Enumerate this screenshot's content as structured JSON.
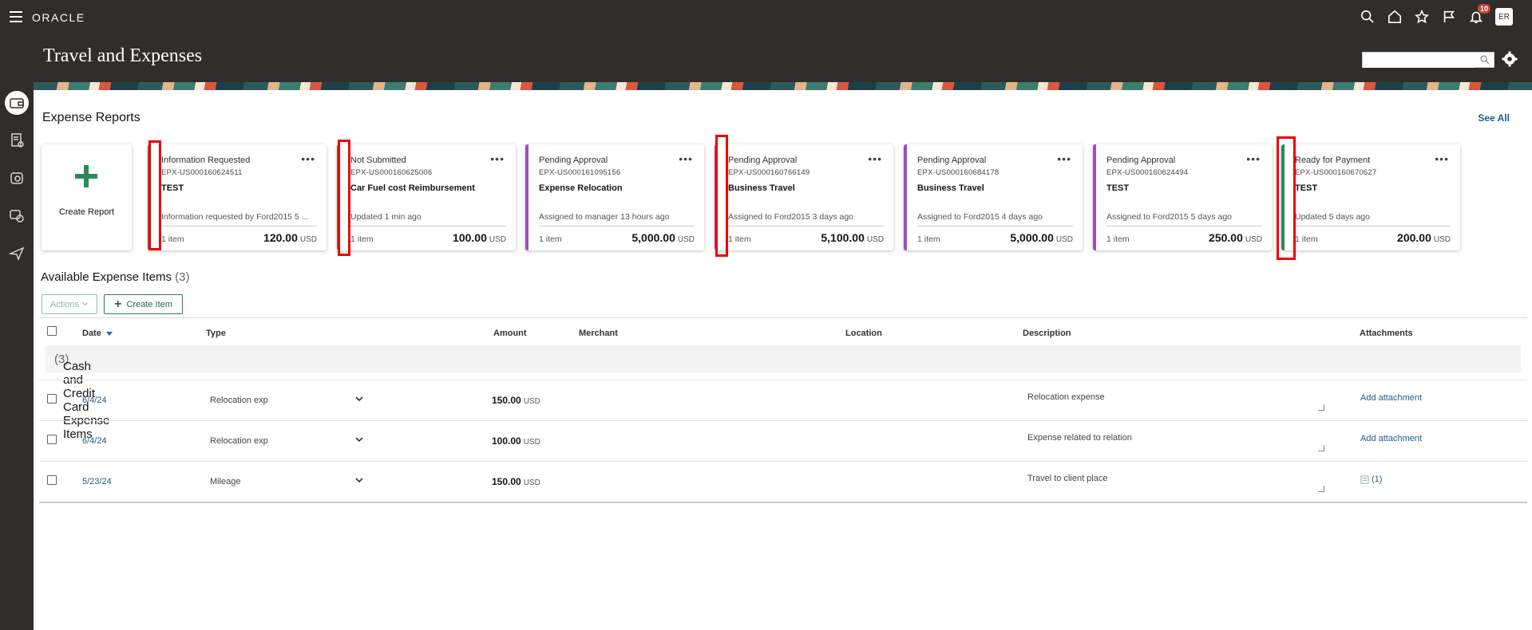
{
  "header": {
    "logo": "ORACLE",
    "title": "Travel and Expenses",
    "notification_count": "10",
    "avatar_initials": "ER",
    "search_placeholder": ""
  },
  "expense_reports": {
    "title": "Expense Reports",
    "see_all": "See All",
    "create_label": "Create Report",
    "cards": [
      {
        "status": "Information Requested",
        "number": "EPX-US000160624511",
        "name": "TEST",
        "info": "Information requested by Ford2015 5 ...",
        "items": "1 item",
        "amount": "120.00",
        "currency": "USD",
        "color": "gray"
      },
      {
        "status": "Not Submitted",
        "number": "EPX-US000160625006",
        "name": "Car Fuel cost Reimbursement",
        "info": "Updated 1 min ago",
        "items": "1 item",
        "amount": "100.00",
        "currency": "USD",
        "color": "gray"
      },
      {
        "status": "Pending Approval",
        "number": "EPX-US000161095156",
        "name": "Expense Relocation",
        "info": "Assigned to manager 13 hours ago",
        "items": "1 item",
        "amount": "5,000.00",
        "currency": "USD",
        "color": "purple"
      },
      {
        "status": "Pending Approval",
        "number": "EPX-US000160766149",
        "name": "Business Travel",
        "info": "Assigned to Ford2015 3 days ago",
        "items": "1 item",
        "amount": "5,100.00",
        "currency": "USD",
        "color": "purple"
      },
      {
        "status": "Pending Approval",
        "number": "EPX-US000160684178",
        "name": "Business Travel",
        "info": "Assigned to Ford2015 4 days ago",
        "items": "1 item",
        "amount": "5,000.00",
        "currency": "USD",
        "color": "purple"
      },
      {
        "status": "Pending Approval",
        "number": "EPX-US000160624494",
        "name": "TEST",
        "info": "Assigned to Ford2015 5 days ago",
        "items": "1 item",
        "amount": "250.00",
        "currency": "USD",
        "color": "purple"
      },
      {
        "status": "Ready for Payment",
        "number": "EPX-US000160670627",
        "name": "TEST",
        "info": "Updated 5 days ago",
        "items": "1 item",
        "amount": "200.00",
        "currency": "USD",
        "color": "green"
      }
    ]
  },
  "available_items": {
    "title": "Available Expense Items",
    "count": "(3)",
    "actions_label": "Actions",
    "create_item_label": "Create Item",
    "columns": {
      "date": "Date",
      "type": "Type",
      "amount": "Amount",
      "merchant": "Merchant",
      "location": "Location",
      "description": "Description",
      "attachments": "Attachments"
    },
    "group": {
      "label": "Cash and Credit Card Expense Items",
      "count": "(3)"
    },
    "rows": [
      {
        "date": "6/4/24",
        "type": "Relocation exp",
        "amount": "150.00",
        "currency": "USD",
        "description": "Relocation expense",
        "attachment": "Add attachment"
      },
      {
        "date": "6/4/24",
        "type": "Relocation exp",
        "amount": "100.00",
        "currency": "USD",
        "description": "Expense related to relation",
        "attachment": "Add attachment"
      },
      {
        "date": "5/23/24",
        "type": "Mileage",
        "amount": "150.00",
        "currency": "USD",
        "description": "Travel to client place",
        "attachment": "(1)"
      }
    ]
  }
}
